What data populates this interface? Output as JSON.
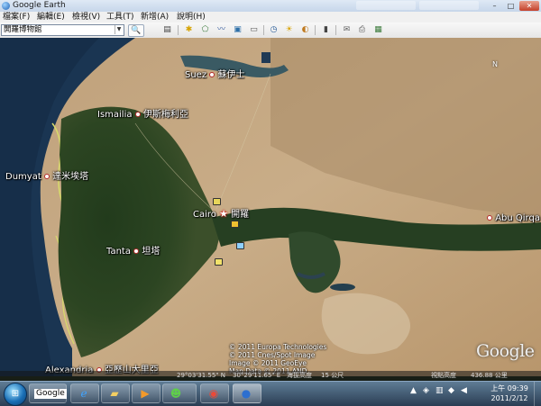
{
  "window": {
    "title": "Google Earth",
    "controls": {
      "minimize": "–",
      "maximize": "□",
      "close": "✕"
    }
  },
  "menu": {
    "items": [
      "檔案(F)",
      "編輯(E)",
      "檢視(V)",
      "工具(T)",
      "新增(A)",
      "說明(H)"
    ]
  },
  "toolbar": {
    "search_value": "開羅博物館",
    "icons": [
      "sidebar-icon",
      "placemark-icon",
      "polygon-icon",
      "path-icon",
      "image-overlay-icon",
      "tour-icon",
      "history-icon",
      "sun-icon",
      "planets-icon",
      "ruler-icon",
      "email-icon",
      "print-icon",
      "maps-icon"
    ]
  },
  "map": {
    "places": [
      {
        "en": "Suez",
        "zh": "蘇伊士"
      },
      {
        "en": "Ismailia",
        "zh": "伊斯梅利亞"
      },
      {
        "en": "Dumyat",
        "zh": "達米埃塔"
      },
      {
        "en": "Cairo",
        "zh": "開羅"
      },
      {
        "en": "Abu Qirqa",
        "zh": ""
      },
      {
        "en": "Tanta",
        "zh": "坦塔"
      },
      {
        "en": "Alexandria",
        "zh": "亞歷山大里亞"
      }
    ],
    "credits": [
      "© 2011 Europa Technologies",
      "© 2011 Cnes/Spot Image",
      "Image © 2011 GeoEye",
      "Map Data © 2011 AND"
    ],
    "logo": "Google"
  },
  "status": {
    "coords_lat": "29°03'31.55\" N",
    "coords_lon": "30°29'11.65\" E",
    "elevation": "海拔高度",
    "elevation_value": "15 公尺",
    "eye_alt": "視點高度",
    "eye_alt_value": "436.88 公里"
  },
  "taskbar": {
    "start": "⊞",
    "search_label": "Google",
    "clock_time": "上午 09:39",
    "clock_date": "2011/2/12",
    "accent": "#2a3d53"
  }
}
